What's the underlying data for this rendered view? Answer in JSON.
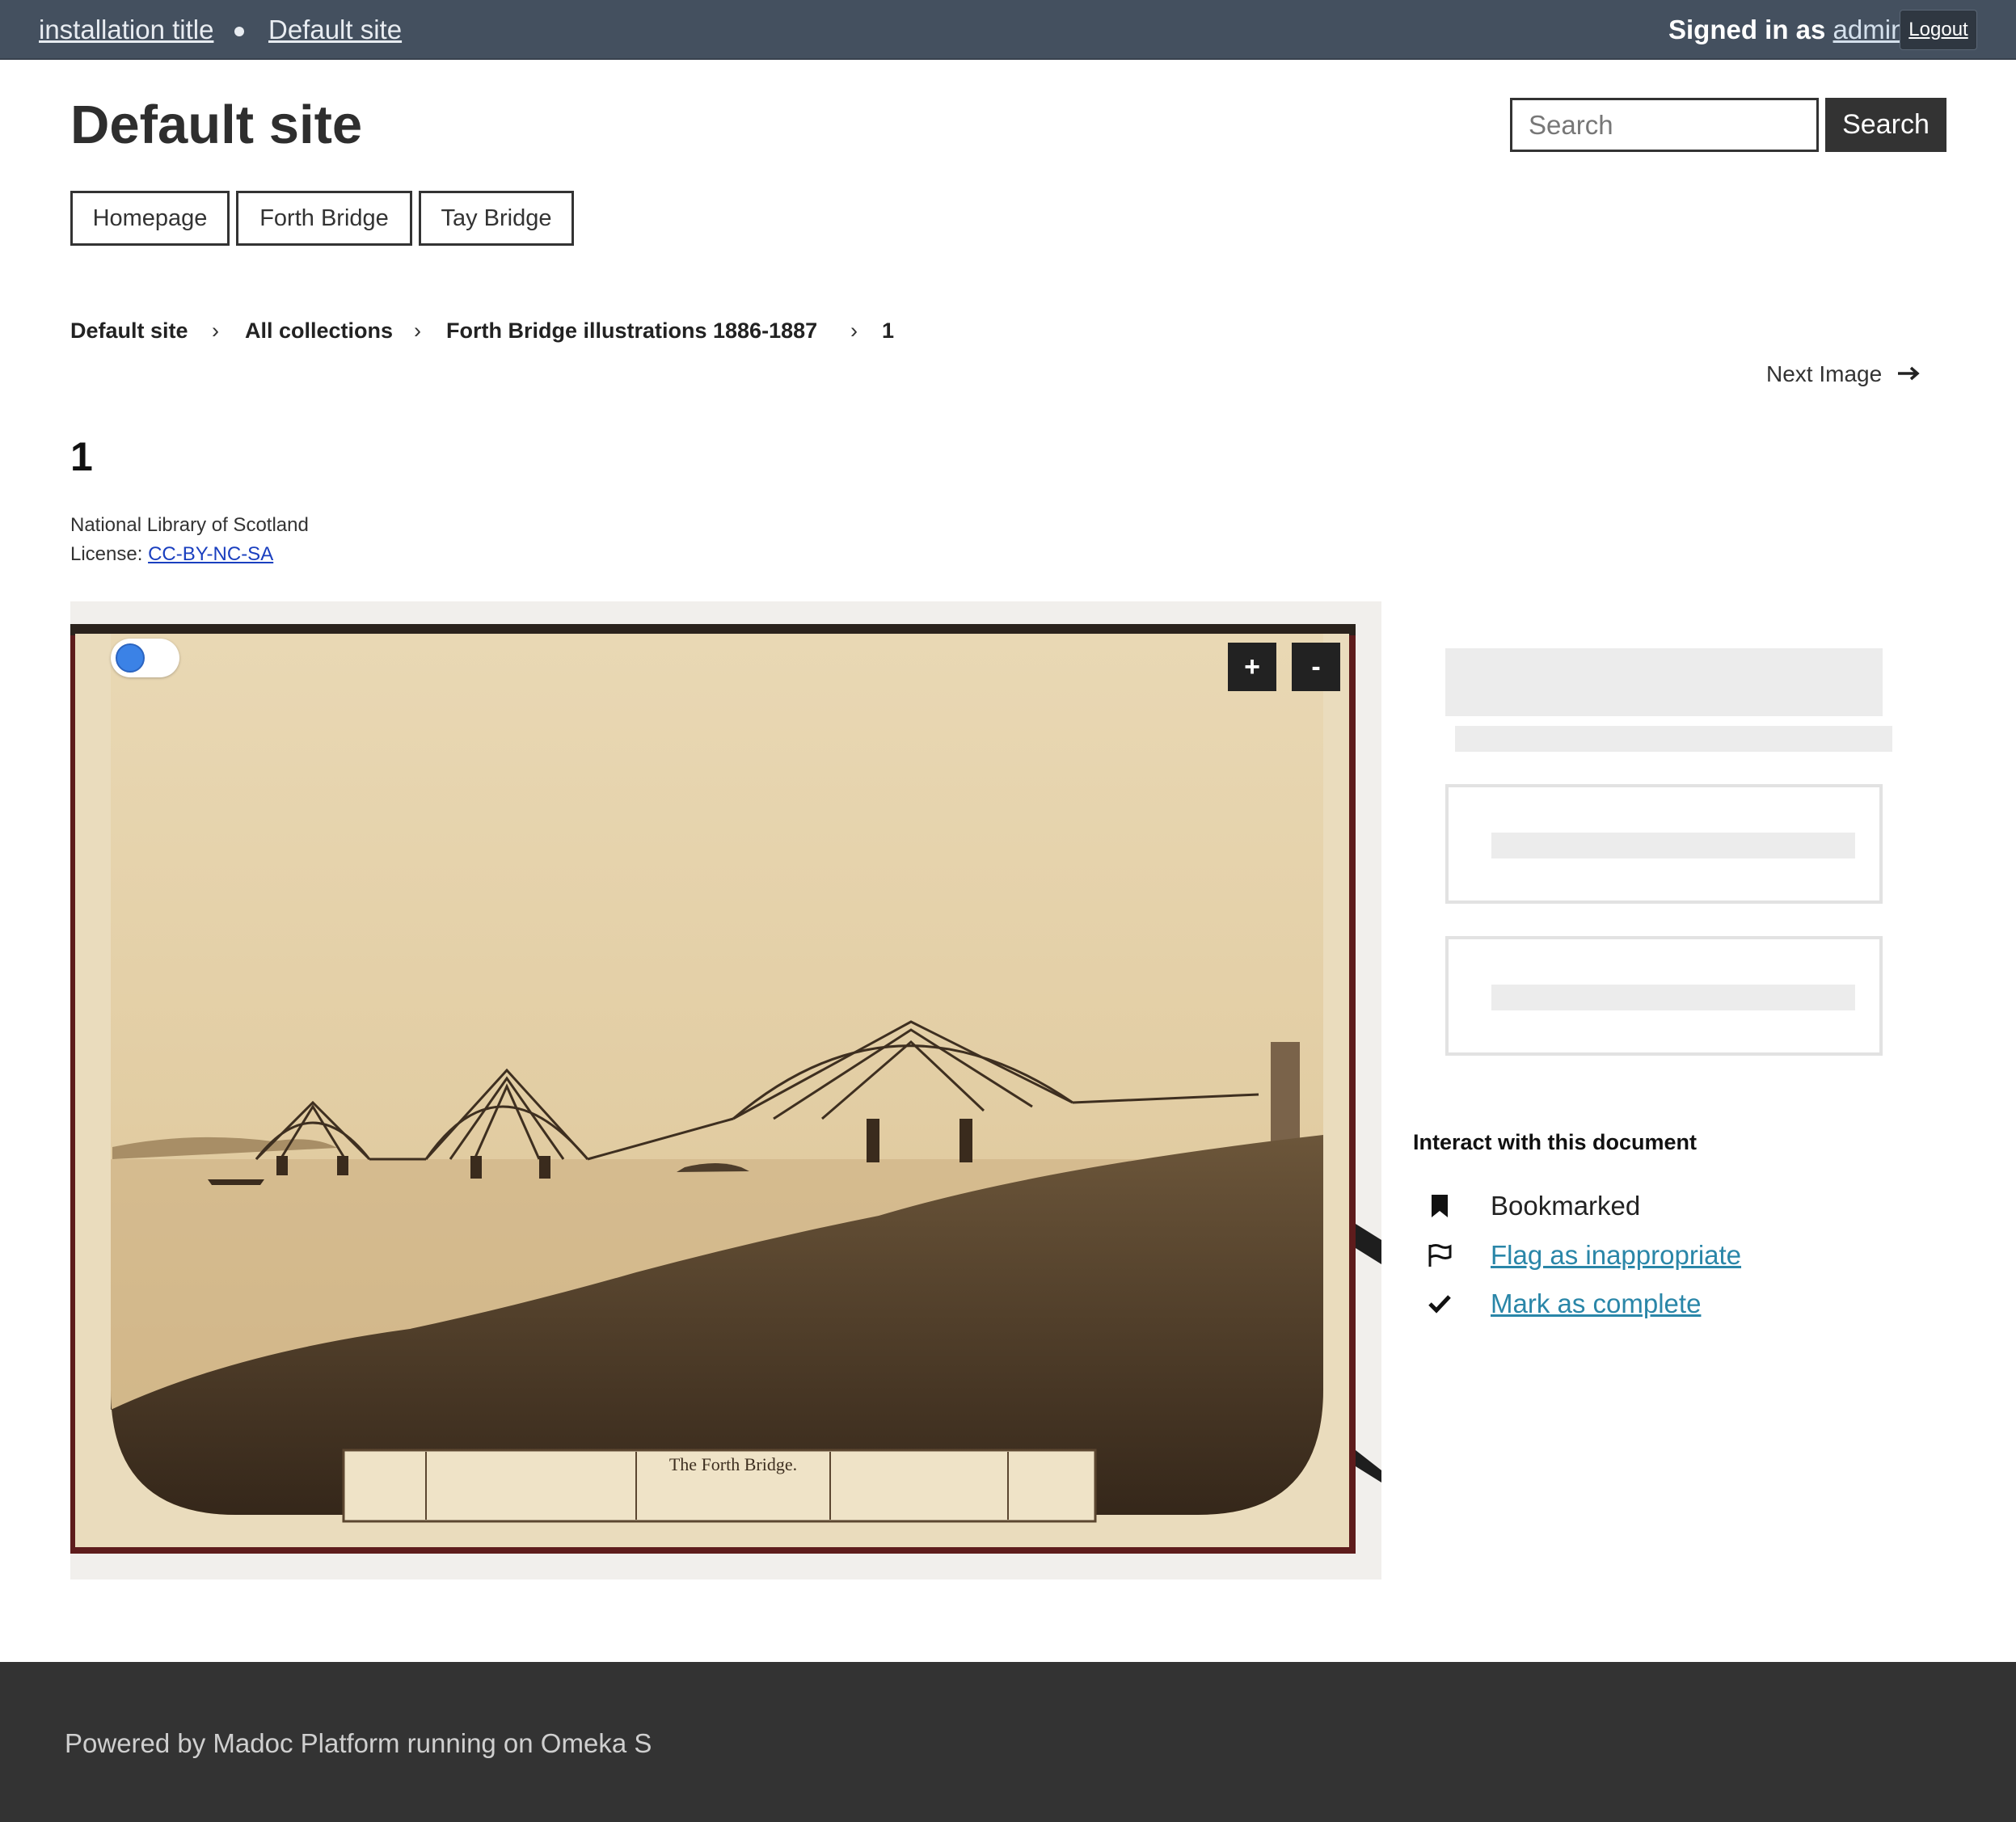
{
  "topbar": {
    "installation_title": "installation title",
    "site_link": "Default site",
    "signed_in_prefix": "Signed in as ",
    "username": "admin",
    "logout": "Logout"
  },
  "header": {
    "site_title": "Default site",
    "search_placeholder": "Search",
    "search_button": "Search"
  },
  "nav": {
    "items": [
      "Homepage",
      "Forth Bridge",
      "Tay Bridge"
    ]
  },
  "breadcrumb": {
    "items": [
      "Default site",
      "All collections",
      "Forth Bridge illustrations 1886-1887",
      "1"
    ],
    "separator": "›"
  },
  "pager": {
    "next_label": "Next Image"
  },
  "document": {
    "title": "1",
    "attribution": "National Library of Scotland",
    "license_label": "License: ",
    "license_value": "CC-BY-NC-SA"
  },
  "viewer": {
    "zoom_in": "+",
    "zoom_out": "-",
    "image_caption": "The Forth Bridge.",
    "colors": {
      "sepia_light": "#e3cfa5",
      "sepia_dark": "#4a3622",
      "border_red": "#6b1f1f"
    }
  },
  "interact": {
    "title": "Interact with this document",
    "bookmarked": "Bookmarked",
    "flag": "Flag as inappropriate",
    "complete": "Mark as complete",
    "link_color": "#2a86a8"
  },
  "footer": {
    "text": "Powered by Madoc Platform running on Omeka S"
  }
}
